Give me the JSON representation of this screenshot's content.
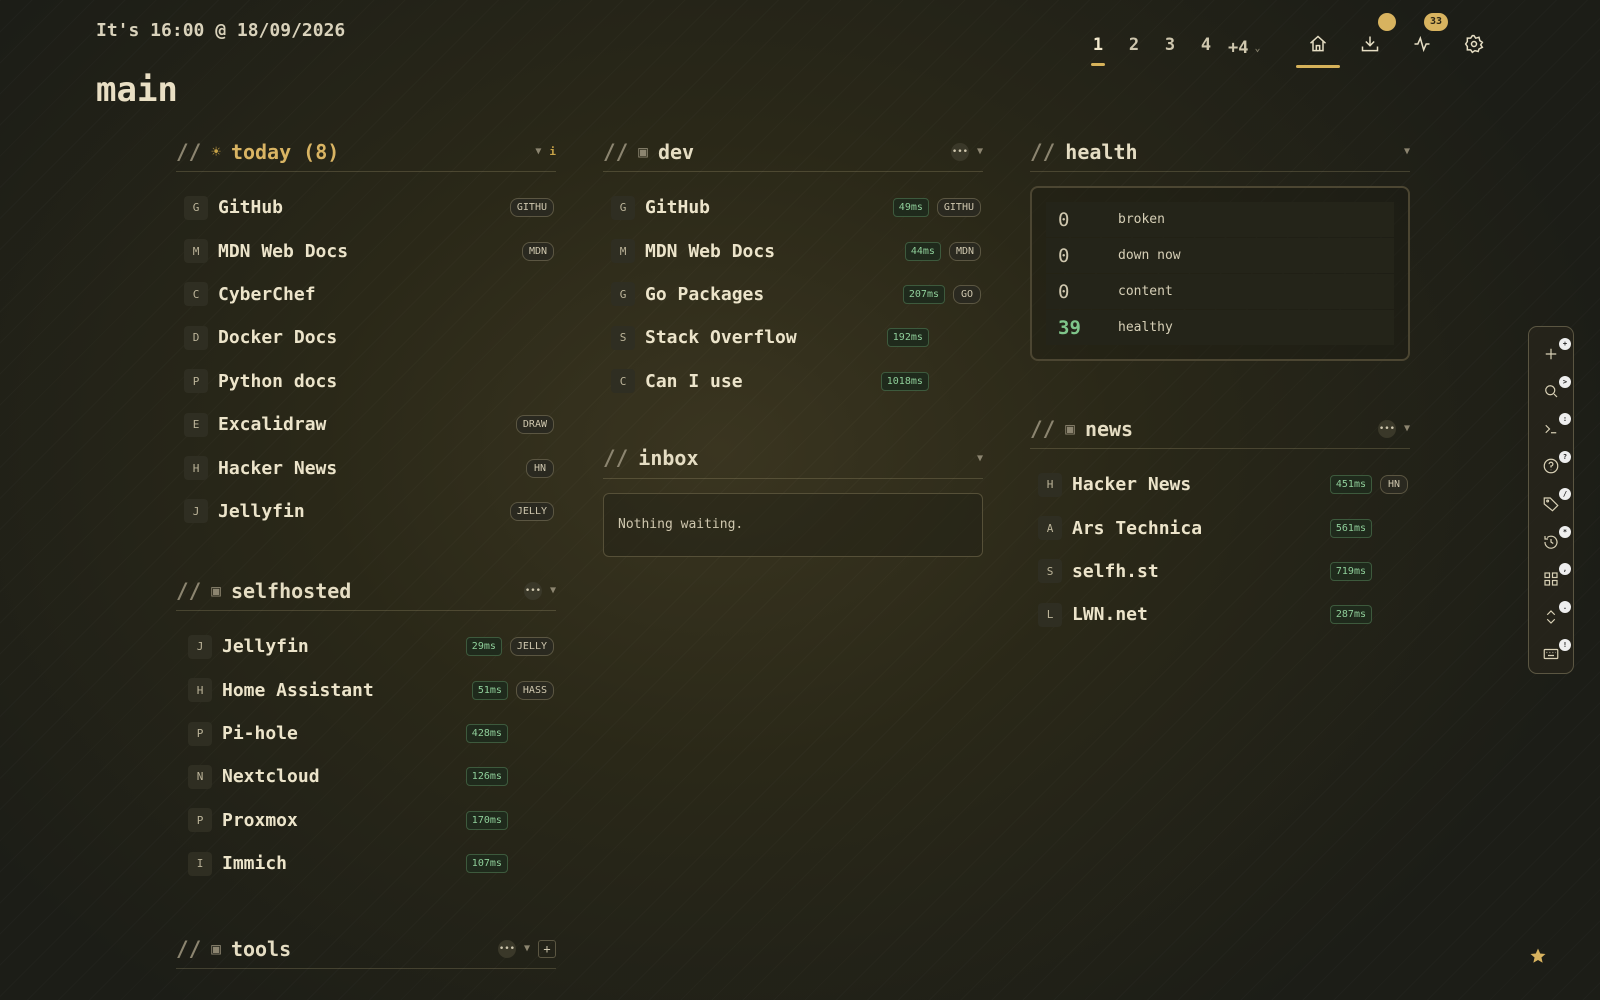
{
  "header": {
    "clock": "It's 16:00 @ 18/09/2026",
    "page_title": "main",
    "workspaces": [
      "1",
      "2",
      "3",
      "4"
    ],
    "workspace_more": "+4",
    "activity_badge": "33"
  },
  "sections": {
    "today": {
      "title": "today (8)",
      "items": [
        {
          "letter": "G",
          "name": "GitHub",
          "tag": "GITHU"
        },
        {
          "letter": "M",
          "name": "MDN Web Docs",
          "tag": "MDN"
        },
        {
          "letter": "C",
          "name": "CyberChef",
          "tag": ""
        },
        {
          "letter": "D",
          "name": "Docker Docs",
          "tag": ""
        },
        {
          "letter": "P",
          "name": "Python docs",
          "tag": ""
        },
        {
          "letter": "E",
          "name": "Excalidraw",
          "tag": "DRAW"
        },
        {
          "letter": "H",
          "name": "Hacker News",
          "tag": "HN"
        },
        {
          "letter": "J",
          "name": "Jellyfin",
          "tag": "JELLY"
        }
      ]
    },
    "selfhosted": {
      "title": "selfhosted",
      "items": [
        {
          "letter": "J",
          "name": "Jellyfin",
          "ms": "29ms",
          "tag": "JELLY"
        },
        {
          "letter": "H",
          "name": "Home Assistant",
          "ms": "51ms",
          "tag": "HASS"
        },
        {
          "letter": "P",
          "name": "Pi-hole",
          "ms": "428ms",
          "tag": ""
        },
        {
          "letter": "N",
          "name": "Nextcloud",
          "ms": "126ms",
          "tag": ""
        },
        {
          "letter": "P",
          "name": "Proxmox",
          "ms": "170ms",
          "tag": ""
        },
        {
          "letter": "I",
          "name": "Immich",
          "ms": "107ms",
          "tag": ""
        }
      ]
    },
    "tools": {
      "title": "tools"
    },
    "dev": {
      "title": "dev",
      "items": [
        {
          "letter": "G",
          "name": "GitHub",
          "ms": "49ms",
          "tag": "GITHU"
        },
        {
          "letter": "M",
          "name": "MDN Web Docs",
          "ms": "44ms",
          "tag": "MDN"
        },
        {
          "letter": "G",
          "name": "Go Packages",
          "ms": "207ms",
          "tag": "GO"
        },
        {
          "letter": "S",
          "name": "Stack Overflow",
          "ms": "192ms",
          "tag": ""
        },
        {
          "letter": "C",
          "name": "Can I use",
          "ms": "1018ms",
          "tag": ""
        }
      ]
    },
    "inbox": {
      "title": "inbox",
      "empty_text": "Nothing waiting."
    },
    "health": {
      "title": "health",
      "rows": [
        {
          "value": "0",
          "label": "broken"
        },
        {
          "value": "0",
          "label": "down now"
        },
        {
          "value": "0",
          "label": "content"
        },
        {
          "value": "39",
          "label": "healthy"
        }
      ]
    },
    "news": {
      "title": "news",
      "items": [
        {
          "letter": "H",
          "name": "Hacker News",
          "ms": "451ms",
          "tag": "HN"
        },
        {
          "letter": "A",
          "name": "Ars Technica",
          "ms": "561ms",
          "tag": ""
        },
        {
          "letter": "S",
          "name": "selfh.st",
          "ms": "719ms",
          "tag": ""
        },
        {
          "letter": "L",
          "name": "LWN.net",
          "ms": "287ms",
          "tag": ""
        }
      ]
    }
  },
  "dock": {
    "items": [
      {
        "icon": "plus-icon",
        "key": "+"
      },
      {
        "icon": "search-icon",
        "key": ">"
      },
      {
        "icon": "terminal-icon",
        "key": ":"
      },
      {
        "icon": "help-icon",
        "key": "?"
      },
      {
        "icon": "tag-icon",
        "key": "/"
      },
      {
        "icon": "history-icon",
        "key": "*"
      },
      {
        "icon": "grid-icon",
        "key": ","
      },
      {
        "icon": "sort-icon",
        "key": "."
      },
      {
        "icon": "keyboard-icon",
        "key": "!"
      }
    ]
  },
  "colors": {
    "accent": "#d8b35f",
    "ok": "#8fcf9a",
    "text": "#ece4ca"
  }
}
